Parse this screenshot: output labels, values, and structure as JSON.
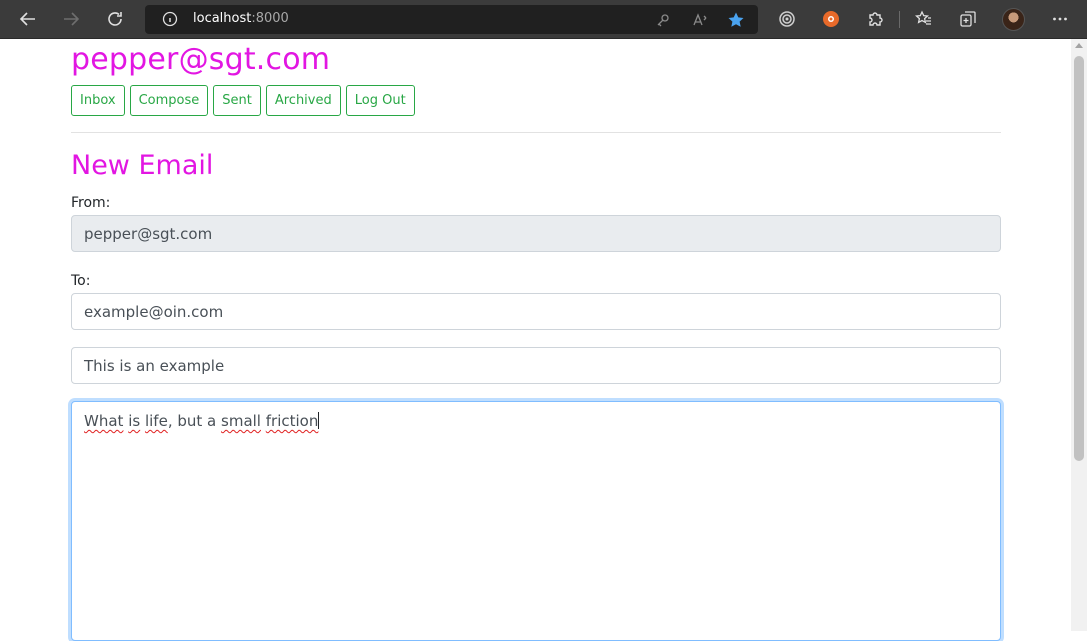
{
  "browser": {
    "address": {
      "host": "localhost",
      "port": ":8000"
    },
    "icons": [
      "back-icon",
      "forward-icon",
      "reload-icon",
      "info-icon",
      "key-icon",
      "read-aloud-icon",
      "favorite-star-icon",
      "tracking-icon",
      "extension-orange-icon",
      "extensions-puzzle-icon",
      "favorites-icon",
      "collections-icon",
      "profile-avatar",
      "more-icon"
    ]
  },
  "header": {
    "user_email": "pepper@sgt.com"
  },
  "nav": {
    "inbox": "Inbox",
    "compose": "Compose",
    "sent": "Sent",
    "archived": "Archived",
    "logout": "Log Out"
  },
  "compose": {
    "title": "New Email",
    "from_label": "From:",
    "from_value": "pepper@sgt.com",
    "to_label": "To:",
    "to_value": "example@oin.com",
    "subject_value": "This is an example",
    "body_words": [
      "What",
      "is",
      "life",
      ", but a",
      "small",
      "friction"
    ]
  },
  "colors": {
    "accent": "#e216e2",
    "button_green": "#28a745",
    "focus_border": "#80bdff"
  }
}
